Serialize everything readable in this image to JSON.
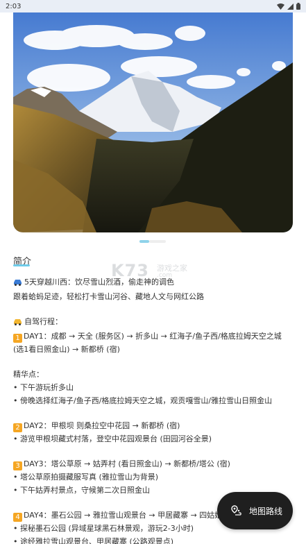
{
  "status_bar": {
    "time": "2:03"
  },
  "gallery": {
    "image_alt": "雪山 山谷 风景",
    "current_page": 1
  },
  "section": {
    "title": "简介"
  },
  "watermark": {
    "main": "K73",
    "sub1": "游戏之家",
    "sub2": ".com"
  },
  "lines": {
    "intro1": "5天穿越川西：饮尽雪山烈酒，偷走神的调色",
    "intro2": "跟着蛤蚂足迹，轻松打卡雪山河谷、藏地人文与网红公路",
    "trip_title": "自驾行程：",
    "day1_num": "1",
    "day1": "DAY1：成都 → 天全 (服务区) → 折多山 → 红海子/鱼子西/格底拉姆天空之城 (选1看日照金山) → 新都桥 (宿)",
    "highlights": "精华点：",
    "d1a": "• 下午游玩折多山",
    "d1b": "• 傍晚选择红海子/鱼子西/格底拉姆天空之城，观贡嘎雪山/雅拉雪山日照金山",
    "day2_num": "2",
    "day2": "DAY2：甲根坝 则桑拉空中花园 → 新都桥 (宿)",
    "d2a": "• 游览甲根坝藏式村落，登空中花园观景台 (田园河谷全景)",
    "day3_num": "3",
    "day3": "DAY3：塔公草原 → 姑弄村 (看日照金山) → 新都桥/塔公 (宿)",
    "d3a": "• 塔公草原拍摄藏服写真 (雅拉雪山为背景)",
    "d3b": "• 下午姑弄村景点，守候第二次日照金山",
    "day4_num": "4",
    "day4": "DAY4：墨石公园 → 雅拉雪山观景台 → 甲居藏寨 → 四姑娘山",
    "d4a": "• 探秘墨石公园 (异域星球黑石林景观，游玩2-3小时)",
    "d4b": "• 途经雅拉雪山观景台、甲居藏寨 (公路观景点)"
  },
  "map_button": {
    "label": "地图路线"
  },
  "colors": {
    "accent": "#6ecbe9",
    "badge": "#f5a623",
    "button_bg": "#1f1f1f"
  },
  "icons": [
    "wifi-icon",
    "signal-icon",
    "battery-icon",
    "car-icon",
    "taxi-icon",
    "route-icon"
  ]
}
